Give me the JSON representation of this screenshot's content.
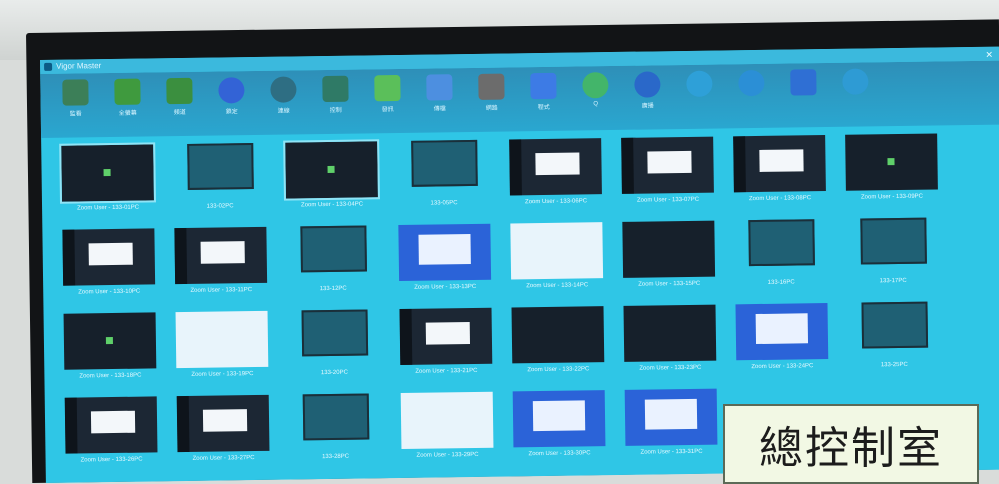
{
  "window": {
    "title": "Vigor Master"
  },
  "toolbar": {
    "items": [
      {
        "label": "監看",
        "icon": "grid-view-icon",
        "color": "#3c7f58"
      },
      {
        "label": "全螢幕",
        "icon": "multi-screen-icon",
        "color": "#3f9a3e"
      },
      {
        "label": "頻道",
        "icon": "channel-icon",
        "color": "#3b8f3f"
      },
      {
        "label": "鎖定",
        "icon": "lock-icon",
        "color": "#3363d6"
      },
      {
        "label": "連線",
        "icon": "screen-share-icon",
        "color": "#2e6e83"
      },
      {
        "label": "控制",
        "icon": "remote-control-icon",
        "color": "#2f7a66"
      },
      {
        "label": "發訊",
        "icon": "message-icon",
        "color": "#5bbf5a"
      },
      {
        "label": "傳檔",
        "icon": "file-transfer-icon",
        "color": "#4d8fe0"
      },
      {
        "label": "網路",
        "icon": "network-icon",
        "color": "#6c6c6c"
      },
      {
        "label": "程式",
        "icon": "apps-icon",
        "color": "#3d7be5"
      },
      {
        "label": "Q",
        "icon": "power-icon",
        "color": "#43b56a"
      },
      {
        "label": "廣播",
        "icon": "broadcast-icon",
        "color": "#2a68c9"
      },
      {
        "label": "",
        "icon": "camera-icon",
        "color": "#2ea0d8"
      },
      {
        "label": "",
        "icon": "globe-icon",
        "color": "#2b8fd6"
      },
      {
        "label": "",
        "icon": "document-icon",
        "color": "#2f6fd4"
      },
      {
        "label": "",
        "icon": "settings-icon",
        "color": "#2e9bd4"
      }
    ]
  },
  "clients": [
    {
      "name": "Zoom User - 133-01PC",
      "style": "dark-dot",
      "selected": true
    },
    {
      "name": "133-02PC",
      "style": "monitor",
      "selected": false
    },
    {
      "name": "Zoom User - 133-04PC",
      "style": "dark-dot",
      "selected": true
    },
    {
      "name": "133-05PC",
      "style": "monitor",
      "selected": false
    },
    {
      "name": "Zoom User - 133-06PC",
      "style": "window",
      "selected": false
    },
    {
      "name": "Zoom User - 133-07PC",
      "style": "window",
      "selected": false
    },
    {
      "name": "Zoom User - 133-08PC",
      "style": "window",
      "selected": false
    },
    {
      "name": "Zoom User - 133-09PC",
      "style": "dark-dot",
      "selected": false
    },
    {
      "name": "Zoom User - 133-10PC",
      "style": "window",
      "selected": false
    },
    {
      "name": "Zoom User - 133-11PC",
      "style": "window",
      "selected": false
    },
    {
      "name": "133-12PC",
      "style": "monitor",
      "selected": false
    },
    {
      "name": "Zoom User - 133-13PC",
      "style": "blue",
      "selected": false
    },
    {
      "name": "Zoom User - 133-14PC",
      "style": "white",
      "selected": false
    },
    {
      "name": "Zoom User - 133-15PC",
      "style": "dark",
      "selected": false
    },
    {
      "name": "133-16PC",
      "style": "monitor",
      "selected": false
    },
    {
      "name": "133-17PC",
      "style": "monitor",
      "selected": false
    },
    {
      "name": "Zoom User - 133-18PC",
      "style": "dark-dot",
      "selected": false
    },
    {
      "name": "Zoom User - 133-19PC",
      "style": "white",
      "selected": false
    },
    {
      "name": "133-20PC",
      "style": "monitor",
      "selected": false
    },
    {
      "name": "Zoom User - 133-21PC",
      "style": "window",
      "selected": false
    },
    {
      "name": "Zoom User - 133-22PC",
      "style": "dark",
      "selected": false
    },
    {
      "name": "Zoom User - 133-23PC",
      "style": "dark",
      "selected": false
    },
    {
      "name": "Zoom User - 133-24PC",
      "style": "blue",
      "selected": false
    },
    {
      "name": "133-25PC",
      "style": "monitor",
      "selected": false
    },
    {
      "name": "Zoom User - 133-26PC",
      "style": "window",
      "selected": false
    },
    {
      "name": "Zoom User - 133-27PC",
      "style": "window",
      "selected": false
    },
    {
      "name": "133-28PC",
      "style": "monitor",
      "selected": false
    },
    {
      "name": "Zoom User - 133-29PC",
      "style": "white",
      "selected": false
    },
    {
      "name": "Zoom User - 133-30PC",
      "style": "blue",
      "selected": false
    },
    {
      "name": "Zoom User - 133-31PC",
      "style": "blue",
      "selected": false
    }
  ],
  "overlay": {
    "text": "總控制室"
  },
  "colors": {
    "screen": "#2fc6e6",
    "bezel": "#121416",
    "overlay_bg": "#f2f8e4"
  }
}
